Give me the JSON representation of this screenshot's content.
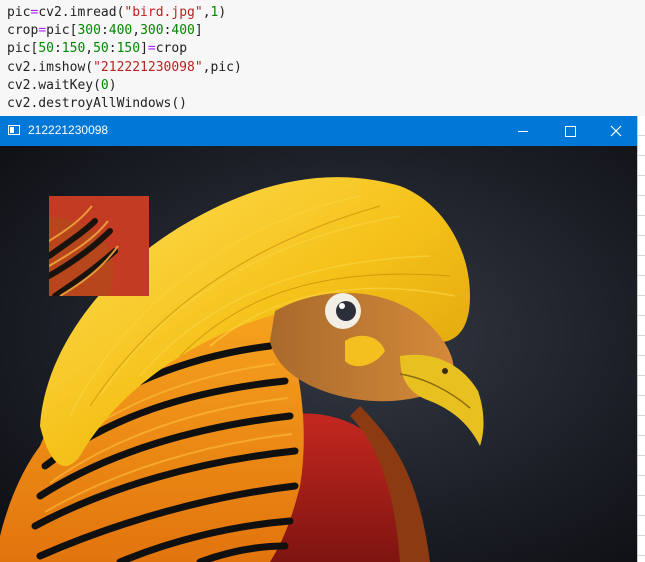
{
  "editor": {
    "lines": [
      [
        {
          "t": "pic",
          "c": "var"
        },
        {
          "t": "=",
          "c": "op"
        },
        {
          "t": "cv2.imread(",
          "c": "var"
        },
        {
          "t": "\"bird.jpg\"",
          "c": "str"
        },
        {
          "t": ",",
          "c": "var"
        },
        {
          "t": "1",
          "c": "num"
        },
        {
          "t": ")",
          "c": "var"
        }
      ],
      [
        {
          "t": "crop",
          "c": "var"
        },
        {
          "t": "=",
          "c": "op"
        },
        {
          "t": "pic[",
          "c": "var"
        },
        {
          "t": "300",
          "c": "num"
        },
        {
          "t": ":",
          "c": "var"
        },
        {
          "t": "400",
          "c": "num"
        },
        {
          "t": ",",
          "c": "var"
        },
        {
          "t": "300",
          "c": "num"
        },
        {
          "t": ":",
          "c": "var"
        },
        {
          "t": "400",
          "c": "num"
        },
        {
          "t": "]",
          "c": "var"
        }
      ],
      [
        {
          "t": "pic[",
          "c": "var"
        },
        {
          "t": "50",
          "c": "num"
        },
        {
          "t": ":",
          "c": "var"
        },
        {
          "t": "150",
          "c": "num"
        },
        {
          "t": ",",
          "c": "var"
        },
        {
          "t": "50",
          "c": "num"
        },
        {
          "t": ":",
          "c": "var"
        },
        {
          "t": "150",
          "c": "num"
        },
        {
          "t": "]",
          "c": "var"
        },
        {
          "t": "=",
          "c": "op"
        },
        {
          "t": "crop",
          "c": "var"
        }
      ],
      [
        {
          "t": "cv2.imshow(",
          "c": "var"
        },
        {
          "t": "\"212221230098\"",
          "c": "str"
        },
        {
          "t": ",pic)",
          "c": "var"
        }
      ],
      [
        {
          "t": "cv2.waitKey(",
          "c": "var"
        },
        {
          "t": "0",
          "c": "num"
        },
        {
          "t": ")",
          "c": "var"
        }
      ],
      [
        {
          "t": "cv2.destroyAllWindows()",
          "c": "var"
        }
      ]
    ]
  },
  "window": {
    "title": "212221230098",
    "buttons": {
      "minimize": "minimize",
      "maximize": "maximize",
      "close": "close"
    }
  },
  "image": {
    "subject": "golden-pheasant",
    "crop_overlay": "pasted-crop"
  },
  "icons": [
    "window-app-icon",
    "minimize-icon",
    "maximize-icon",
    "close-icon"
  ],
  "colors": {
    "titlebar": "#0078d7",
    "string": "#ba2121",
    "number": "#008800",
    "operator": "#aa22ff"
  }
}
